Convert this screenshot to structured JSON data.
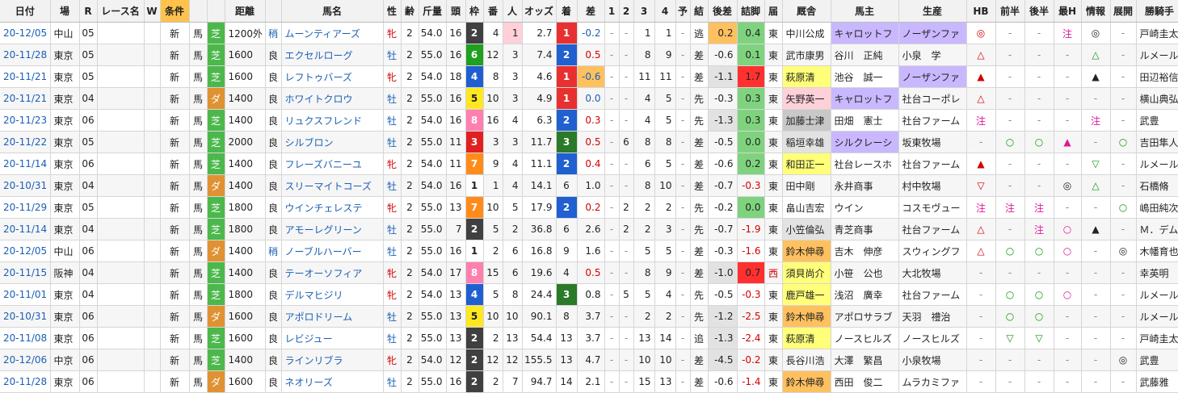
{
  "headers": [
    "日付",
    "場",
    "R",
    "レース名",
    "W",
    "条件",
    "",
    "",
    "距離",
    "",
    "馬名",
    "性",
    "齢",
    "斤量",
    "頭",
    "枠",
    "番",
    "人",
    "オッズ",
    "着",
    "差",
    "1",
    "2",
    "3",
    "4",
    "予",
    "結",
    "後差",
    "詰脚",
    "届",
    "厩舎",
    "馬主",
    "生産",
    "HB",
    "前半",
    "後半",
    "最H",
    "情報",
    "展開",
    "勝騎手"
  ],
  "rows": [
    {
      "date": "20-12/05",
      "place": "中山",
      "r": "05",
      "cls": "新",
      "ba": "馬",
      "surf": "芝",
      "dist": "1200外",
      "cond": "稍",
      "name": "ムーンティアーズ",
      "sex": "牝",
      "age": "2",
      "kin": "54.0",
      "tou": "16",
      "waku": "2",
      "ban": "4",
      "nin": "1",
      "odds": "2.7",
      "chaku": "1",
      "sa": "-0.2",
      "c1": "-",
      "c2": "-",
      "c3": "1",
      "c4": "1",
      "yo": "-",
      "ke": "逃",
      "kousa": "0.2",
      "tsume": "0.4",
      "todoke": "東",
      "trainer": "中川公成",
      "owner": "キャロットフ",
      "breeder": "ノーザンファ",
      "hb": "◎",
      "zen": "-",
      "kou": "-",
      "saih": "注",
      "joho": "◎",
      "tenkai": "-",
      "jockey": "戸崎圭太"
    },
    {
      "date": "20-11/28",
      "place": "東京",
      "r": "05",
      "cls": "新",
      "ba": "馬",
      "surf": "芝",
      "dist": "1600",
      "cond": "良",
      "name": "エクセルローグ",
      "sex": "牡",
      "age": "2",
      "kin": "55.0",
      "tou": "16",
      "waku": "6",
      "ban": "12",
      "nin": "3",
      "odds": "7.4",
      "chaku": "2",
      "sa": "0.5",
      "c1": "-",
      "c2": "-",
      "c3": "8",
      "c4": "9",
      "yo": "-",
      "ke": "差",
      "kousa": "-0.6",
      "tsume": "0.1",
      "todoke": "東",
      "trainer": "武市康男",
      "owner": "谷川　正純",
      "breeder": "小泉　学",
      "hb": "△",
      "zen": "-",
      "kou": "-",
      "saih": "-",
      "joho": "△",
      "tenkai": "-",
      "jockey": "ルメール"
    },
    {
      "date": "20-11/21",
      "place": "東京",
      "r": "05",
      "cls": "新",
      "ba": "馬",
      "surf": "芝",
      "dist": "1600",
      "cond": "良",
      "name": "レフトゥバーズ",
      "sex": "牝",
      "age": "2",
      "kin": "54.0",
      "tou": "18",
      "waku": "4",
      "ban": "8",
      "nin": "3",
      "odds": "4.6",
      "chaku": "1",
      "sa": "-0.6",
      "c1": "-",
      "c2": "-",
      "c3": "11",
      "c4": "11",
      "yo": "-",
      "ke": "差",
      "kousa": "-1.1",
      "tsume": "1.7",
      "todoke": "東",
      "trainer": "萩原清",
      "owner": "池谷　誠一",
      "breeder": "ノーザンファ",
      "hb": "▲",
      "zen": "-",
      "kou": "-",
      "saih": "-",
      "joho": "▲",
      "tenkai": "-",
      "jockey": "田辺裕信"
    },
    {
      "date": "20-11/21",
      "place": "東京",
      "r": "04",
      "cls": "新",
      "ba": "馬",
      "surf": "ダ",
      "dist": "1400",
      "cond": "良",
      "name": "ホワイトクロウ",
      "sex": "牡",
      "age": "2",
      "kin": "55.0",
      "tou": "16",
      "waku": "5",
      "ban": "10",
      "nin": "3",
      "odds": "4.9",
      "chaku": "1",
      "sa": "0.0",
      "c1": "-",
      "c2": "-",
      "c3": "4",
      "c4": "5",
      "yo": "-",
      "ke": "先",
      "kousa": "-0.3",
      "tsume": "0.3",
      "todoke": "東",
      "trainer": "矢野英一",
      "owner": "キャロットフ",
      "breeder": "社台コーポレ",
      "hb": "△",
      "zen": "-",
      "kou": "-",
      "saih": "-",
      "joho": "-",
      "tenkai": "-",
      "jockey": "横山典弘"
    },
    {
      "date": "20-11/23",
      "place": "東京",
      "r": "06",
      "cls": "新",
      "ba": "馬",
      "surf": "芝",
      "dist": "1400",
      "cond": "良",
      "name": "リュクスフレンド",
      "sex": "牡",
      "age": "2",
      "kin": "54.0",
      "tou": "16",
      "waku": "8",
      "ban": "16",
      "nin": "4",
      "odds": "6.3",
      "chaku": "2",
      "sa": "0.3",
      "c1": "-",
      "c2": "-",
      "c3": "4",
      "c4": "5",
      "yo": "-",
      "ke": "先",
      "kousa": "-1.3",
      "tsume": "0.3",
      "todoke": "東",
      "trainer": "加藤士津",
      "owner": "田畑　憲士",
      "breeder": "社台ファーム",
      "hb": "注",
      "zen": "-",
      "kou": "-",
      "saih": "-",
      "joho": "注",
      "tenkai": "-",
      "jockey": "武豊"
    },
    {
      "date": "20-11/22",
      "place": "東京",
      "r": "05",
      "cls": "新",
      "ba": "馬",
      "surf": "芝",
      "dist": "2000",
      "cond": "良",
      "name": "シルブロン",
      "sex": "牡",
      "age": "2",
      "kin": "55.0",
      "tou": "11",
      "waku": "3",
      "ban": "3",
      "nin": "3",
      "odds": "11.7",
      "chaku": "3",
      "sa": "0.5",
      "c1": "-",
      "c2": "6",
      "c3": "8",
      "c4": "8",
      "yo": "-",
      "ke": "差",
      "kousa": "-0.5",
      "tsume": "0.0",
      "todoke": "東",
      "trainer": "稲垣幸雄",
      "owner": "シルクレーシ",
      "breeder": "坂東牧場",
      "hb": "-",
      "zen": "○",
      "kou": "○",
      "saih": "▲",
      "joho": "-",
      "tenkai": "○",
      "jockey": "吉田隼人"
    },
    {
      "date": "20-11/14",
      "place": "東京",
      "r": "06",
      "cls": "新",
      "ba": "馬",
      "surf": "芝",
      "dist": "1400",
      "cond": "良",
      "name": "フレーズバニーユ",
      "sex": "牝",
      "age": "2",
      "kin": "54.0",
      "tou": "11",
      "waku": "7",
      "ban": "9",
      "nin": "4",
      "odds": "11.1",
      "chaku": "2",
      "sa": "0.4",
      "c1": "-",
      "c2": "-",
      "c3": "6",
      "c4": "5",
      "yo": "-",
      "ke": "差",
      "kousa": "-0.6",
      "tsume": "0.2",
      "todoke": "東",
      "trainer": "和田正一",
      "owner": "社台レースホ",
      "breeder": "社台ファーム",
      "hb": "▲",
      "zen": "-",
      "kou": "-",
      "saih": "-",
      "joho": "▽",
      "tenkai": "-",
      "jockey": "ルメール"
    },
    {
      "date": "20-10/31",
      "place": "東京",
      "r": "04",
      "cls": "新",
      "ba": "馬",
      "surf": "ダ",
      "dist": "1400",
      "cond": "良",
      "name": "スリーマイトコーズ",
      "sex": "牡",
      "age": "2",
      "kin": "54.0",
      "tou": "16",
      "waku": "1",
      "ban": "1",
      "nin": "4",
      "odds": "14.1",
      "chaku": "6",
      "sa": "1.0",
      "c1": "-",
      "c2": "-",
      "c3": "8",
      "c4": "10",
      "yo": "-",
      "ke": "差",
      "kousa": "-0.7",
      "tsume": "-0.3",
      "todoke": "東",
      "trainer": "田中剛",
      "owner": "永井商事",
      "breeder": "村中牧場",
      "hb": "▽",
      "zen": "-",
      "kou": "-",
      "saih": "◎",
      "joho": "△",
      "tenkai": "-",
      "jockey": "石橋脩"
    },
    {
      "date": "20-11/29",
      "place": "東京",
      "r": "05",
      "cls": "新",
      "ba": "馬",
      "surf": "芝",
      "dist": "1800",
      "cond": "良",
      "name": "ウインチェレステ",
      "sex": "牝",
      "age": "2",
      "kin": "55.0",
      "tou": "13",
      "waku": "7",
      "ban": "10",
      "nin": "5",
      "odds": "17.9",
      "chaku": "2",
      "sa": "0.2",
      "c1": "-",
      "c2": "2",
      "c3": "2",
      "c4": "2",
      "yo": "-",
      "ke": "先",
      "kousa": "-0.2",
      "tsume": "0.0",
      "todoke": "東",
      "trainer": "畠山吉宏",
      "owner": "ウイン",
      "breeder": "コスモヴュー",
      "hb": "注",
      "zen": "注",
      "kou": "注",
      "saih": "-",
      "joho": "-",
      "tenkai": "○",
      "jockey": "嶋田純次"
    },
    {
      "date": "20-11/14",
      "place": "東京",
      "r": "04",
      "cls": "新",
      "ba": "馬",
      "surf": "芝",
      "dist": "1800",
      "cond": "良",
      "name": "アモーレグリーン",
      "sex": "牡",
      "age": "2",
      "kin": "55.0",
      "tou": "7",
      "waku": "2",
      "ban": "5",
      "nin": "2",
      "odds": "36.8",
      "chaku": "6",
      "sa": "2.6",
      "c1": "-",
      "c2": "2",
      "c3": "2",
      "c4": "3",
      "yo": "-",
      "ke": "先",
      "kousa": "-0.7",
      "tsume": "-1.9",
      "todoke": "東",
      "trainer": "小笠倫弘",
      "owner": "青芝商事",
      "breeder": "社台ファーム",
      "hb": "△",
      "zen": "-",
      "kou": "注",
      "saih": "○",
      "joho": "▲",
      "tenkai": "-",
      "jockey": "Ｍ．デム"
    },
    {
      "date": "20-12/05",
      "place": "中山",
      "r": "06",
      "cls": "新",
      "ba": "馬",
      "surf": "ダ",
      "dist": "1400",
      "cond": "稍",
      "name": "ノーブルハーバー",
      "sex": "牡",
      "age": "2",
      "kin": "55.0",
      "tou": "16",
      "waku": "1",
      "ban": "2",
      "nin": "6",
      "odds": "16.8",
      "chaku": "9",
      "sa": "1.6",
      "c1": "-",
      "c2": "-",
      "c3": "5",
      "c4": "5",
      "yo": "-",
      "ke": "差",
      "kousa": "-0.3",
      "tsume": "-1.6",
      "todoke": "東",
      "trainer": "鈴木伸尋",
      "owner": "吉木　伸彦",
      "breeder": "スウィングフ",
      "hb": "△",
      "zen": "○",
      "kou": "○",
      "saih": "○",
      "joho": "-",
      "tenkai": "◎",
      "jockey": "木幡育也"
    },
    {
      "date": "20-11/15",
      "place": "阪神",
      "r": "04",
      "cls": "新",
      "ba": "馬",
      "surf": "芝",
      "dist": "1400",
      "cond": "良",
      "name": "テーオーソフィア",
      "sex": "牝",
      "age": "2",
      "kin": "54.0",
      "tou": "17",
      "waku": "8",
      "ban": "15",
      "nin": "6",
      "odds": "19.6",
      "chaku": "4",
      "sa": "0.5",
      "c1": "-",
      "c2": "-",
      "c3": "8",
      "c4": "9",
      "yo": "-",
      "ke": "差",
      "kousa": "-1.0",
      "tsume": "0.7",
      "todoke": "西",
      "trainer": "須貝尚介",
      "owner": "小笹　公也",
      "breeder": "大北牧場",
      "hb": "-",
      "zen": "-",
      "kou": "-",
      "saih": "-",
      "joho": "-",
      "tenkai": "-",
      "jockey": "幸英明"
    },
    {
      "date": "20-11/01",
      "place": "東京",
      "r": "04",
      "cls": "新",
      "ba": "馬",
      "surf": "芝",
      "dist": "1800",
      "cond": "良",
      "name": "デルマヒジリ",
      "sex": "牝",
      "age": "2",
      "kin": "54.0",
      "tou": "13",
      "waku": "4",
      "ban": "5",
      "nin": "8",
      "odds": "24.4",
      "chaku": "3",
      "sa": "0.8",
      "c1": "-",
      "c2": "5",
      "c3": "5",
      "c4": "4",
      "yo": "-",
      "ke": "先",
      "kousa": "-0.5",
      "tsume": "-0.3",
      "todoke": "東",
      "trainer": "鹿戸雄一",
      "owner": "浅沼　廣幸",
      "breeder": "社台ファーム",
      "hb": "-",
      "zen": "○",
      "kou": "○",
      "saih": "○",
      "joho": "-",
      "tenkai": "-",
      "jockey": "ルメール"
    },
    {
      "date": "20-10/31",
      "place": "東京",
      "r": "06",
      "cls": "新",
      "ba": "馬",
      "surf": "ダ",
      "dist": "1600",
      "cond": "良",
      "name": "アポロドリーム",
      "sex": "牡",
      "age": "2",
      "kin": "55.0",
      "tou": "13",
      "waku": "5",
      "ban": "10",
      "nin": "10",
      "odds": "90.1",
      "chaku": "8",
      "sa": "3.7",
      "c1": "-",
      "c2": "-",
      "c3": "2",
      "c4": "2",
      "yo": "-",
      "ke": "先",
      "kousa": "-1.2",
      "tsume": "-2.5",
      "todoke": "東",
      "trainer": "鈴木伸尋",
      "owner": "アポロサラブ",
      "breeder": "天羽　禮治",
      "hb": "-",
      "zen": "○",
      "kou": "○",
      "saih": "-",
      "joho": "-",
      "tenkai": "-",
      "jockey": "ルメール"
    },
    {
      "date": "20-11/08",
      "place": "東京",
      "r": "06",
      "cls": "新",
      "ba": "馬",
      "surf": "芝",
      "dist": "1600",
      "cond": "良",
      "name": "レビジュー",
      "sex": "牡",
      "age": "2",
      "kin": "55.0",
      "tou": "13",
      "waku": "2",
      "ban": "2",
      "nin": "13",
      "odds": "54.4",
      "chaku": "13",
      "sa": "3.7",
      "c1": "-",
      "c2": "-",
      "c3": "13",
      "c4": "14",
      "yo": "-",
      "ke": "追",
      "kousa": "-1.3",
      "tsume": "-2.4",
      "todoke": "東",
      "trainer": "萩原清",
      "owner": "ノースヒルズ",
      "breeder": "ノースヒルズ",
      "hb": "-",
      "zen": "▽",
      "kou": "▽",
      "saih": "-",
      "joho": "-",
      "tenkai": "-",
      "jockey": "戸崎圭太"
    },
    {
      "date": "20-12/06",
      "place": "中京",
      "r": "06",
      "cls": "新",
      "ba": "馬",
      "surf": "芝",
      "dist": "1400",
      "cond": "良",
      "name": "ラインリブラ",
      "sex": "牝",
      "age": "2",
      "kin": "54.0",
      "tou": "12",
      "waku": "2",
      "ban": "12",
      "nin": "12",
      "odds": "155.5",
      "chaku": "13",
      "sa": "4.7",
      "c1": "-",
      "c2": "-",
      "c3": "10",
      "c4": "10",
      "yo": "-",
      "ke": "差",
      "kousa": "-4.5",
      "tsume": "-0.2",
      "todoke": "東",
      "trainer": "長谷川浩",
      "owner": "大澤　繁昌",
      "breeder": "小泉牧場",
      "hb": "-",
      "zen": "-",
      "kou": "-",
      "saih": "-",
      "joho": "-",
      "tenkai": "◎",
      "jockey": "武豊"
    },
    {
      "date": "20-11/28",
      "place": "東京",
      "r": "06",
      "cls": "新",
      "ba": "馬",
      "surf": "ダ",
      "dist": "1600",
      "cond": "良",
      "name": "ネオリーズ",
      "sex": "牡",
      "age": "2",
      "kin": "55.0",
      "tou": "16",
      "waku": "2",
      "ban": "2",
      "nin": "7",
      "odds": "94.7",
      "chaku": "14",
      "sa": "2.1",
      "c1": "-",
      "c2": "-",
      "c3": "15",
      "c4": "13",
      "yo": "-",
      "ke": "差",
      "kousa": "-0.6",
      "tsume": "-1.4",
      "todoke": "東",
      "trainer": "鈴木伸尋",
      "owner": "西田　俊二",
      "breeder": "ムラカミファ",
      "hb": "-",
      "zen": "-",
      "kou": "-",
      "saih": "-",
      "joho": "-",
      "tenkai": "-",
      "jockey": "武藤雅"
    }
  ],
  "colors": {
    "waku": {
      "1": "#ffffff",
      "2": "#404040",
      "3": "#e02020",
      "4": "#1f5fd0",
      "5": "#ffe820",
      "6": "#1fa01f",
      "7": "#ff8c1a",
      "8": "#ff7fb0"
    },
    "chaku": {
      "1": "#e83030",
      "2": "#2060d0",
      "3": "#2a7a2a"
    },
    "turf": "#4cb84c",
    "dirt": "#e09232"
  }
}
